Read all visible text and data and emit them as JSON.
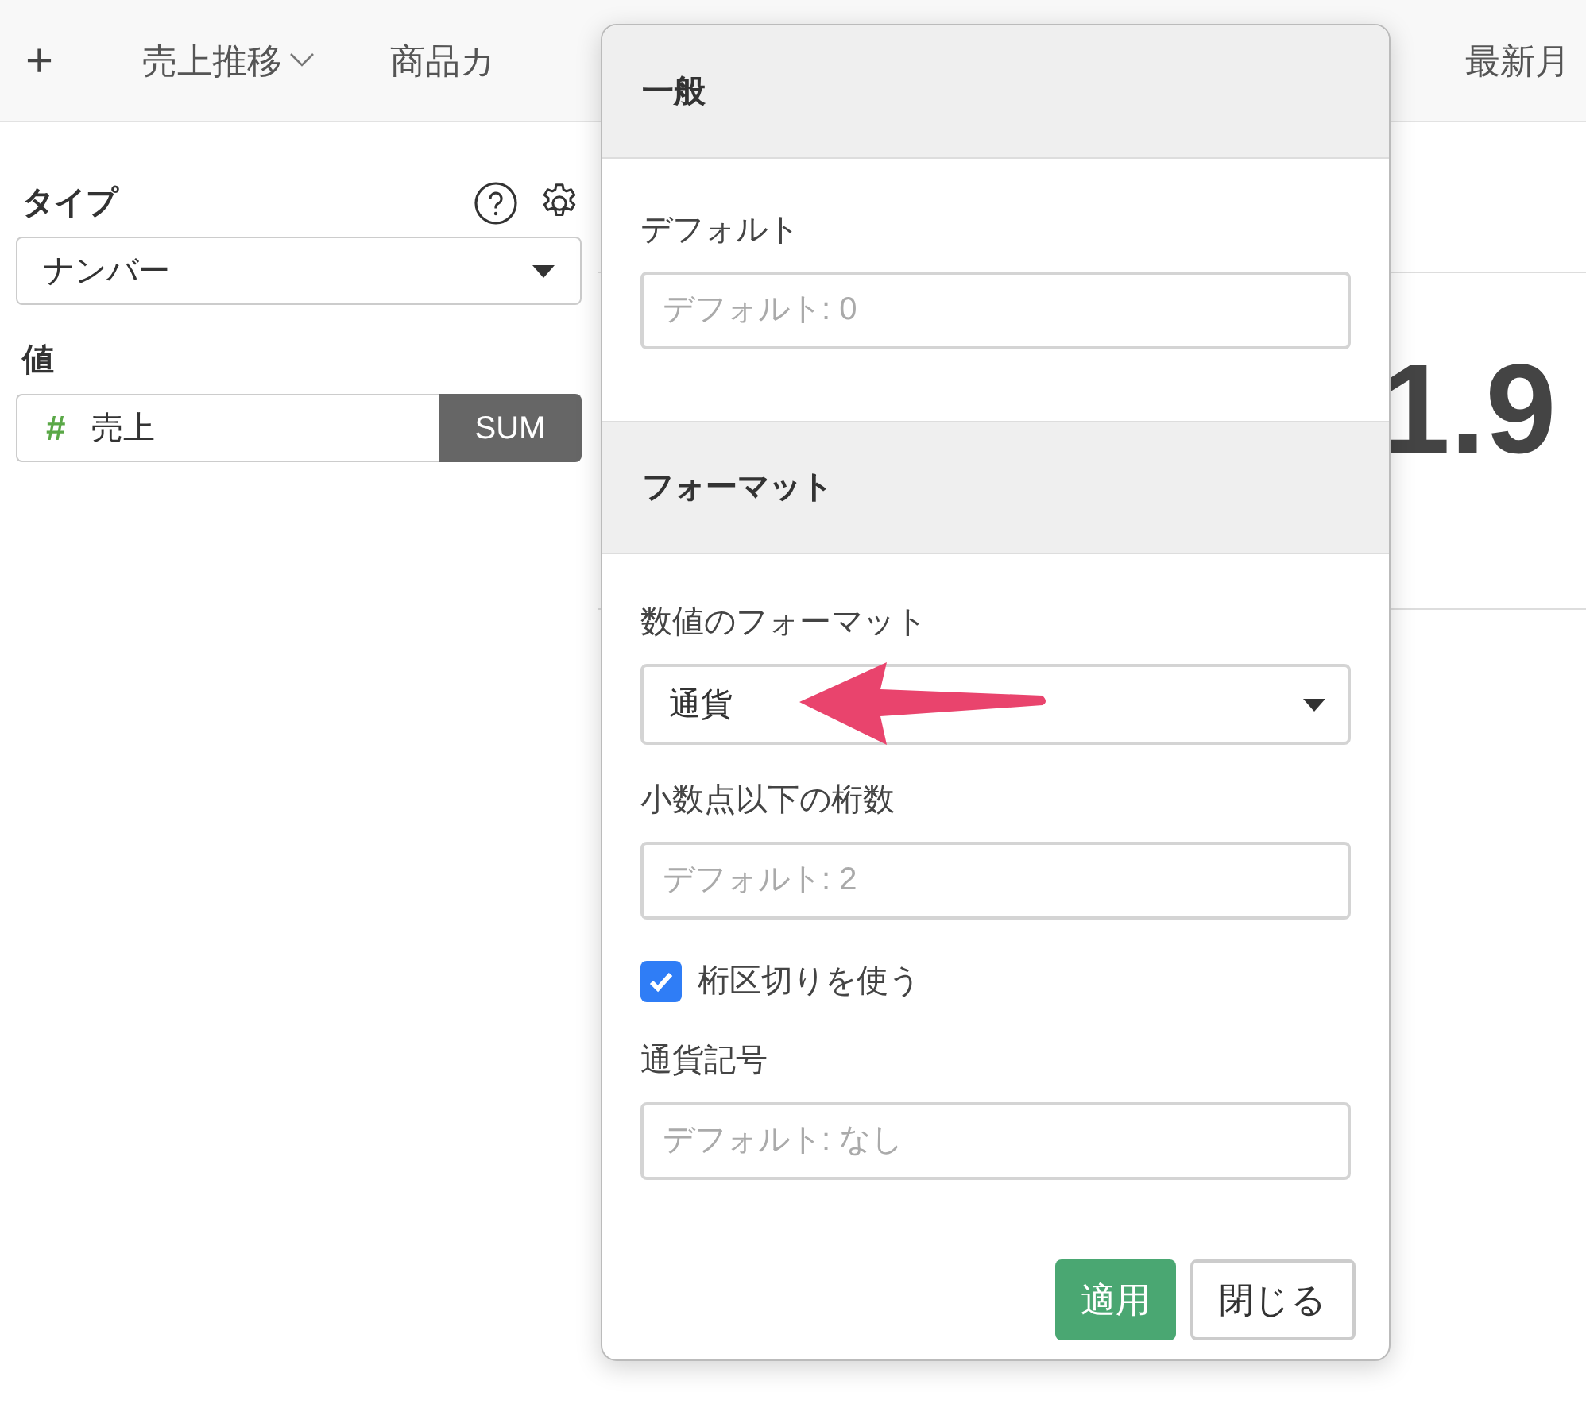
{
  "toolbar": {
    "tabs": [
      {
        "label": "+",
        "kind": "add"
      },
      {
        "label": "売上推移",
        "kind": "dropdown"
      },
      {
        "label": "商品カ",
        "kind": "plain"
      }
    ],
    "right_tab": "最新月"
  },
  "left_panel": {
    "type_label": "タイプ",
    "type_select": "ナンバー",
    "value_label": "値",
    "value_field": {
      "icon": "#",
      "name": "売上",
      "aggregation": "SUM"
    }
  },
  "main": {
    "big_number": "1.9"
  },
  "popup": {
    "sections": [
      {
        "title": "一般",
        "fields": [
          {
            "kind": "input",
            "label": "デフォルト",
            "placeholder": "デフォルト: 0"
          }
        ]
      },
      {
        "title": "フォーマット",
        "fields": [
          {
            "kind": "select",
            "label": "数値のフォーマット",
            "value": "通貨"
          },
          {
            "kind": "input",
            "label": "小数点以下の桁数",
            "placeholder": "デフォルト: 2"
          },
          {
            "kind": "checkbox",
            "label": "桁区切りを使う",
            "checked": true
          },
          {
            "kind": "input",
            "label": "通貨記号",
            "placeholder": "デフォルト: なし"
          }
        ]
      }
    ],
    "buttons": [
      {
        "label": "適用",
        "kind": "primary"
      },
      {
        "label": "閉じる",
        "kind": "default"
      }
    ]
  }
}
